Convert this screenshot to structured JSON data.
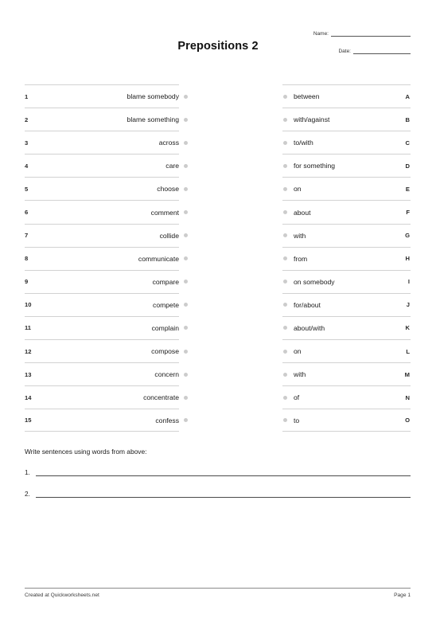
{
  "document": {
    "title": "Prepositions 2",
    "name_label": "Name:",
    "date_label": "Date:"
  },
  "matching": {
    "left_items": [
      {
        "number": "1",
        "word": "blame somebody"
      },
      {
        "number": "2",
        "word": "blame something"
      },
      {
        "number": "3",
        "word": "across"
      },
      {
        "number": "4",
        "word": "care"
      },
      {
        "number": "5",
        "word": "choose"
      },
      {
        "number": "6",
        "word": "comment"
      },
      {
        "number": "7",
        "word": "collide"
      },
      {
        "number": "8",
        "word": "communicate"
      },
      {
        "number": "9",
        "word": "compare"
      },
      {
        "number": "10",
        "word": "compete"
      },
      {
        "number": "11",
        "word": "complain"
      },
      {
        "number": "12",
        "word": "compose"
      },
      {
        "number": "13",
        "word": "concern"
      },
      {
        "number": "14",
        "word": "concentrate"
      },
      {
        "number": "15",
        "word": "confess"
      }
    ],
    "right_items": [
      {
        "letter": "A",
        "word": "between"
      },
      {
        "letter": "B",
        "word": "with/against"
      },
      {
        "letter": "C",
        "word": "to/with"
      },
      {
        "letter": "D",
        "word": "for something"
      },
      {
        "letter": "E",
        "word": "on"
      },
      {
        "letter": "F",
        "word": "about"
      },
      {
        "letter": "G",
        "word": "with"
      },
      {
        "letter": "H",
        "word": "from"
      },
      {
        "letter": "I",
        "word": "on somebody"
      },
      {
        "letter": "J",
        "word": "for/about"
      },
      {
        "letter": "K",
        "word": "about/with"
      },
      {
        "letter": "L",
        "word": "on"
      },
      {
        "letter": "M",
        "word": "with"
      },
      {
        "letter": "N",
        "word": "of"
      },
      {
        "letter": "O",
        "word": "to"
      }
    ]
  },
  "write_section": {
    "prompt": "Write sentences using words from above:",
    "lines": [
      {
        "number": "1."
      },
      {
        "number": "2."
      }
    ]
  },
  "footer": {
    "credit": "Created at Quickworksheets.net",
    "page": "Page 1"
  },
  "colors": {
    "rule": "#d2d2d2",
    "dot": "#cccccc",
    "text": "#1c1c1c",
    "footer_rule": "#8a8a8a"
  }
}
